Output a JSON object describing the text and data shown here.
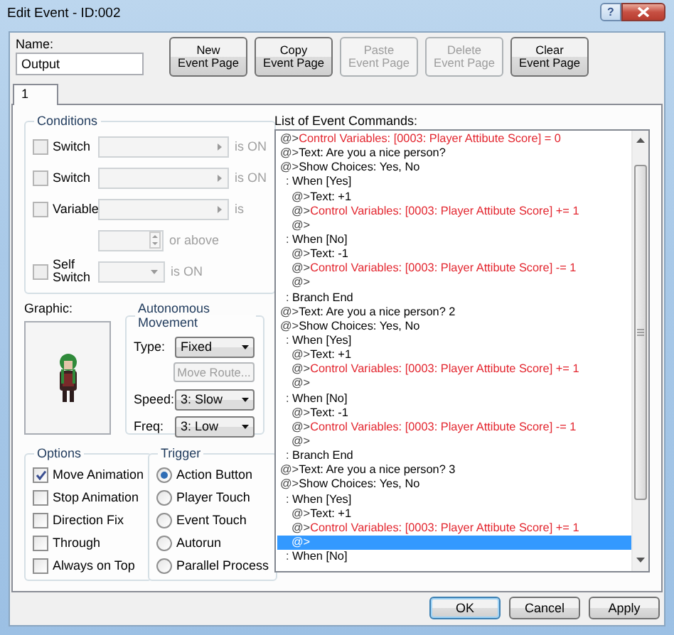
{
  "window": {
    "title": "Edit Event - ID:002",
    "help_button": "?"
  },
  "name": {
    "label": "Name:",
    "value": "Output"
  },
  "page_buttons": [
    {
      "label": "New\nEvent Page",
      "disabled": false
    },
    {
      "label": "Copy\nEvent Page",
      "disabled": false
    },
    {
      "label": "Paste\nEvent Page",
      "disabled": true
    },
    {
      "label": "Delete\nEvent Page",
      "disabled": true
    },
    {
      "label": "Clear\nEvent Page",
      "disabled": false
    }
  ],
  "tabs": [
    {
      "label": "1",
      "selected": true
    }
  ],
  "conditions": {
    "title": "Conditions",
    "rows": [
      {
        "kind": "switch",
        "label": "Switch",
        "checked": false,
        "suffix": "is ON"
      },
      {
        "kind": "switch",
        "label": "Switch",
        "checked": false,
        "suffix": "is ON"
      },
      {
        "kind": "variable",
        "label": "Variable",
        "checked": false,
        "suffix": "is",
        "extra": "or above"
      },
      {
        "kind": "self_switch",
        "label": "Self\nSwitch",
        "checked": false,
        "suffix": "is ON"
      }
    ]
  },
  "graphic": {
    "label": "Graphic:"
  },
  "movement": {
    "title": "Autonomous Movement",
    "type": {
      "label": "Type:",
      "value": "Fixed"
    },
    "route_button": {
      "label": "Move Route...",
      "disabled": true
    },
    "speed": {
      "label": "Speed:",
      "value": "3: Slow"
    },
    "freq": {
      "label": "Freq:",
      "value": "3: Low"
    }
  },
  "options": {
    "title": "Options",
    "items": [
      {
        "label": "Move Animation",
        "checked": true
      },
      {
        "label": "Stop Animation",
        "checked": false
      },
      {
        "label": "Direction Fix",
        "checked": false
      },
      {
        "label": "Through",
        "checked": false
      },
      {
        "label": "Always on Top",
        "checked": false
      }
    ]
  },
  "trigger": {
    "title": "Trigger",
    "items": [
      {
        "label": "Action Button",
        "selected": true
      },
      {
        "label": "Player Touch",
        "selected": false
      },
      {
        "label": "Event Touch",
        "selected": false
      },
      {
        "label": "Autorun",
        "selected": false
      },
      {
        "label": "Parallel Process",
        "selected": false
      }
    ]
  },
  "commands": {
    "label": "List of Event Commands:",
    "rows": [
      {
        "marker": "@>",
        "text": "Control Variables: [0003: Player Attibute Score] = 0",
        "kind": "control",
        "selected": false
      },
      {
        "marker": "@>",
        "text": "Text: Are you a nice person?",
        "kind": "command",
        "selected": false
      },
      {
        "marker": "@>",
        "text": "Show Choices: Yes, No",
        "kind": "command",
        "selected": false,
        "children": [
          {
            "marker": ":",
            "text": "When [Yes]",
            "kind": "branch",
            "selected": false,
            "children": [
              {
                "marker": "@>",
                "text": "Text: +1",
                "kind": "command",
                "selected": false
              },
              {
                "marker": "@>",
                "text": "Control Variables: [0003: Player Attibute Score] += 1",
                "kind": "control",
                "selected": false
              },
              {
                "marker": "@>",
                "kind": "command",
                "selected": false
              }
            ]
          },
          {
            "marker": ":",
            "text": "When [No]",
            "kind": "branch",
            "selected": false,
            "children": [
              {
                "marker": "@>",
                "text": "Text: -1",
                "kind": "command",
                "selected": false
              },
              {
                "marker": "@>",
                "text": "Control Variables: [0003: Player Attibute Score] -= 1",
                "kind": "control",
                "selected": false
              },
              {
                "marker": "@>",
                "kind": "command",
                "selected": false
              }
            ]
          },
          {
            "marker": ":",
            "text": "Branch End",
            "kind": "branch",
            "selected": false
          }
        ]
      },
      {
        "marker": "@>",
        "text": "Text: Are you a nice person? 2",
        "kind": "command",
        "selected": false
      },
      {
        "marker": "@>",
        "text": "Show Choices: Yes, No",
        "kind": "command",
        "selected": false,
        "children": [
          {
            "marker": ":",
            "text": "When [Yes]",
            "kind": "branch",
            "selected": false,
            "children": [
              {
                "marker": "@>",
                "text": "Text: +1",
                "kind": "command",
                "selected": false
              },
              {
                "marker": "@>",
                "text": "Control Variables: [0003: Player Attibute Score] += 1",
                "kind": "control",
                "selected": false
              },
              {
                "marker": "@>",
                "kind": "command",
                "selected": false
              }
            ]
          },
          {
            "marker": ":",
            "text": "When [No]",
            "kind": "branch",
            "selected": false,
            "children": [
              {
                "marker": "@>",
                "text": "Text: -1",
                "kind": "command",
                "selected": false
              },
              {
                "marker": "@>",
                "text": "Control Variables: [0003: Player Attibute Score] -= 1",
                "kind": "control",
                "selected": false
              },
              {
                "marker": "@>",
                "kind": "command",
                "selected": false
              }
            ]
          },
          {
            "marker": ":",
            "text": "Branch End",
            "kind": "branch",
            "selected": false
          }
        ]
      },
      {
        "marker": "@>",
        "text": "Text: Are you a nice person? 3",
        "kind": "command",
        "selected": false
      },
      {
        "marker": "@>",
        "text": "Show Choices: Yes, No",
        "kind": "command",
        "selected": false,
        "children": [
          {
            "marker": ":",
            "text": "When [Yes]",
            "kind": "branch",
            "selected": false,
            "children": [
              {
                "marker": "@>",
                "text": "Text: +1",
                "kind": "command",
                "selected": false
              },
              {
                "marker": "@>",
                "text": "Control Variables: [0003: Player Attibute Score] += 1",
                "kind": "control",
                "selected": false
              },
              {
                "marker": "@>",
                "kind": "command",
                "selected": true
              }
            ]
          },
          {
            "marker": ":",
            "text": "When [No]",
            "kind": "branch",
            "selected": false
          }
        ]
      }
    ]
  },
  "dialog_buttons": [
    {
      "label": "OK",
      "default": true
    },
    {
      "label": "Cancel",
      "default": false
    },
    {
      "label": "Apply",
      "default": false
    }
  ]
}
